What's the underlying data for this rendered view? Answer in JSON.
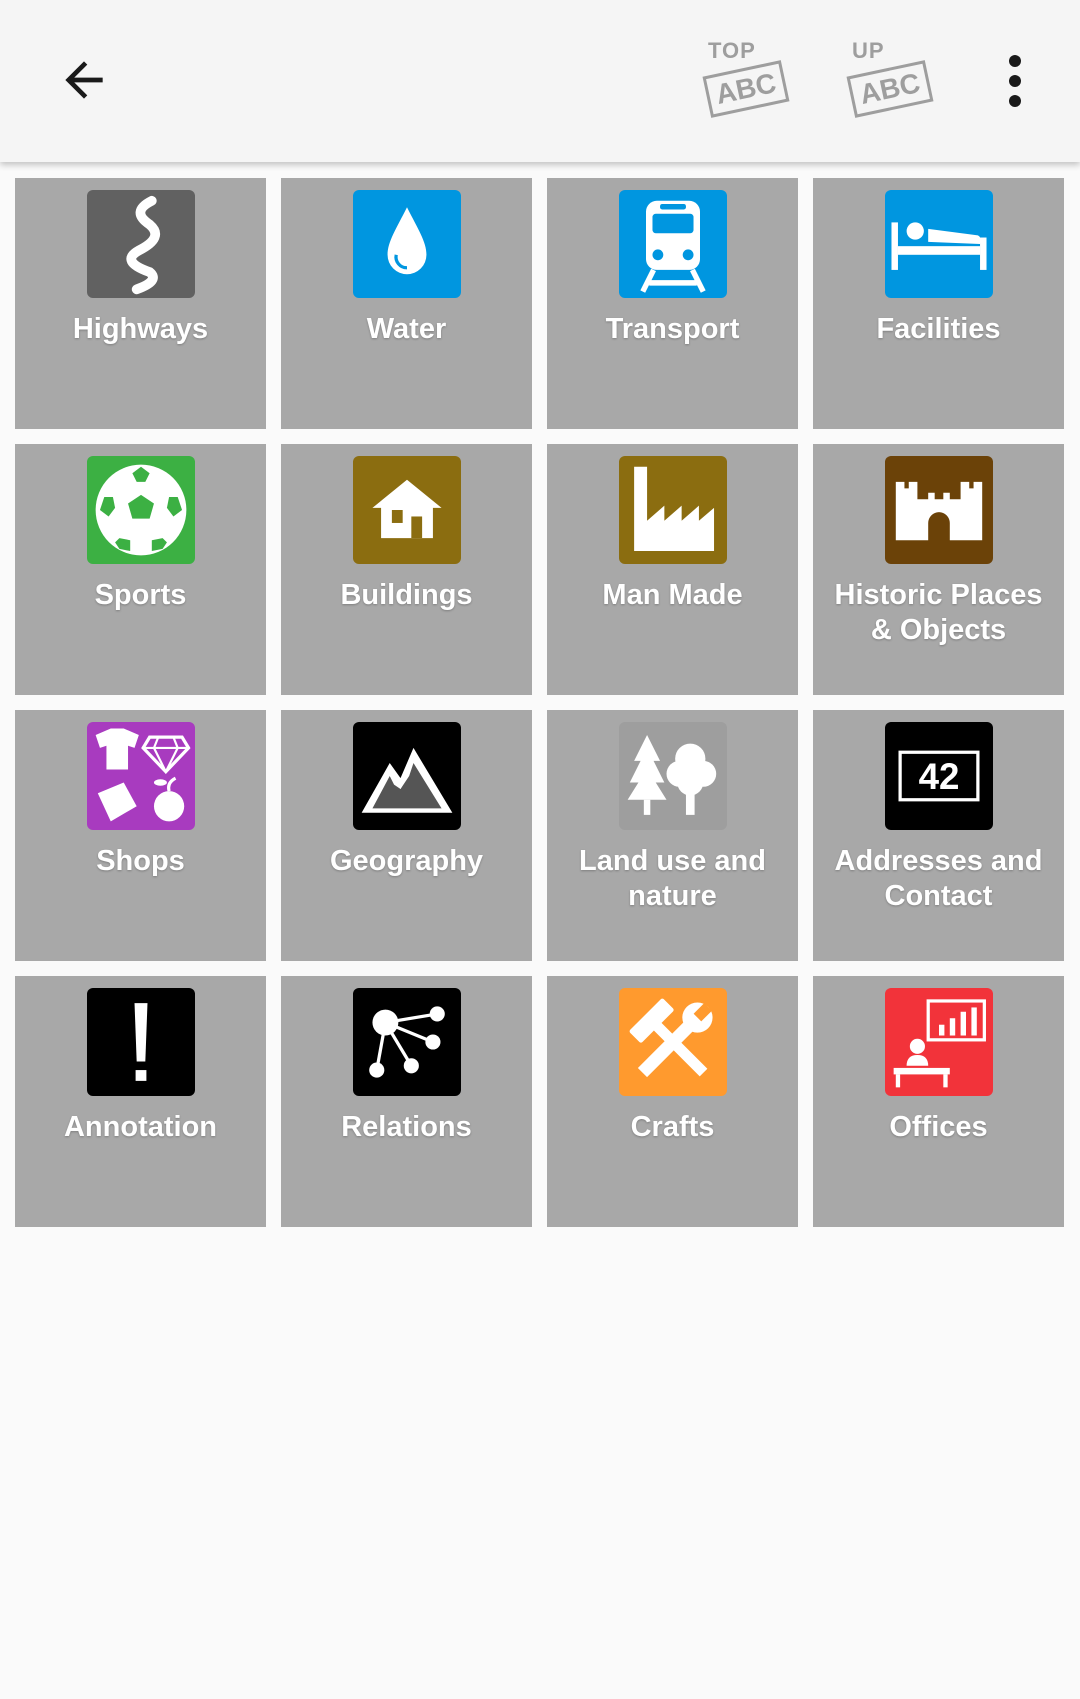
{
  "toolbar": {
    "back_icon": "arrow-left-icon",
    "sort_top": {
      "small": "TOP",
      "box": "ABC"
    },
    "sort_up": {
      "small": "UP",
      "box": "ABC"
    },
    "overflow_icon": "more-vert-icon"
  },
  "categories": [
    {
      "label": "Highways",
      "icon": "highway-road-icon",
      "color": "#616161"
    },
    {
      "label": "Water",
      "icon": "water-drop-icon",
      "color": "#0096e0"
    },
    {
      "label": "Transport",
      "icon": "train-icon",
      "color": "#0096e0"
    },
    {
      "label": "Facilities",
      "icon": "bed-icon",
      "color": "#0096e0"
    },
    {
      "label": "Sports",
      "icon": "soccer-ball-icon",
      "color": "#3cb043"
    },
    {
      "label": "Buildings",
      "icon": "house-icon",
      "color": "#8b6d10"
    },
    {
      "label": "Man Made",
      "icon": "factory-icon",
      "color": "#8b6d10"
    },
    {
      "label": "Historic Places & Objects",
      "icon": "castle-icon",
      "color": "#6b4208"
    },
    {
      "label": "Shops",
      "icon": "shopping-icon",
      "color": "#a83bbf"
    },
    {
      "label": "Geography",
      "icon": "mountain-icon",
      "color": "#000000"
    },
    {
      "label": "Land use and nature",
      "icon": "trees-icon",
      "color": "#9e9e9e"
    },
    {
      "label": "Addresses and Contact",
      "icon": "house-number-icon",
      "color": "#000000",
      "number": "42"
    },
    {
      "label": "Annotation",
      "icon": "exclamation-icon",
      "color": "#000000"
    },
    {
      "label": "Relations",
      "icon": "network-icon",
      "color": "#000000"
    },
    {
      "label": "Crafts",
      "icon": "hammer-wrench-icon",
      "color": "#ff9a2e"
    },
    {
      "label": "Offices",
      "icon": "office-chart-icon",
      "color": "#f2333a"
    }
  ]
}
